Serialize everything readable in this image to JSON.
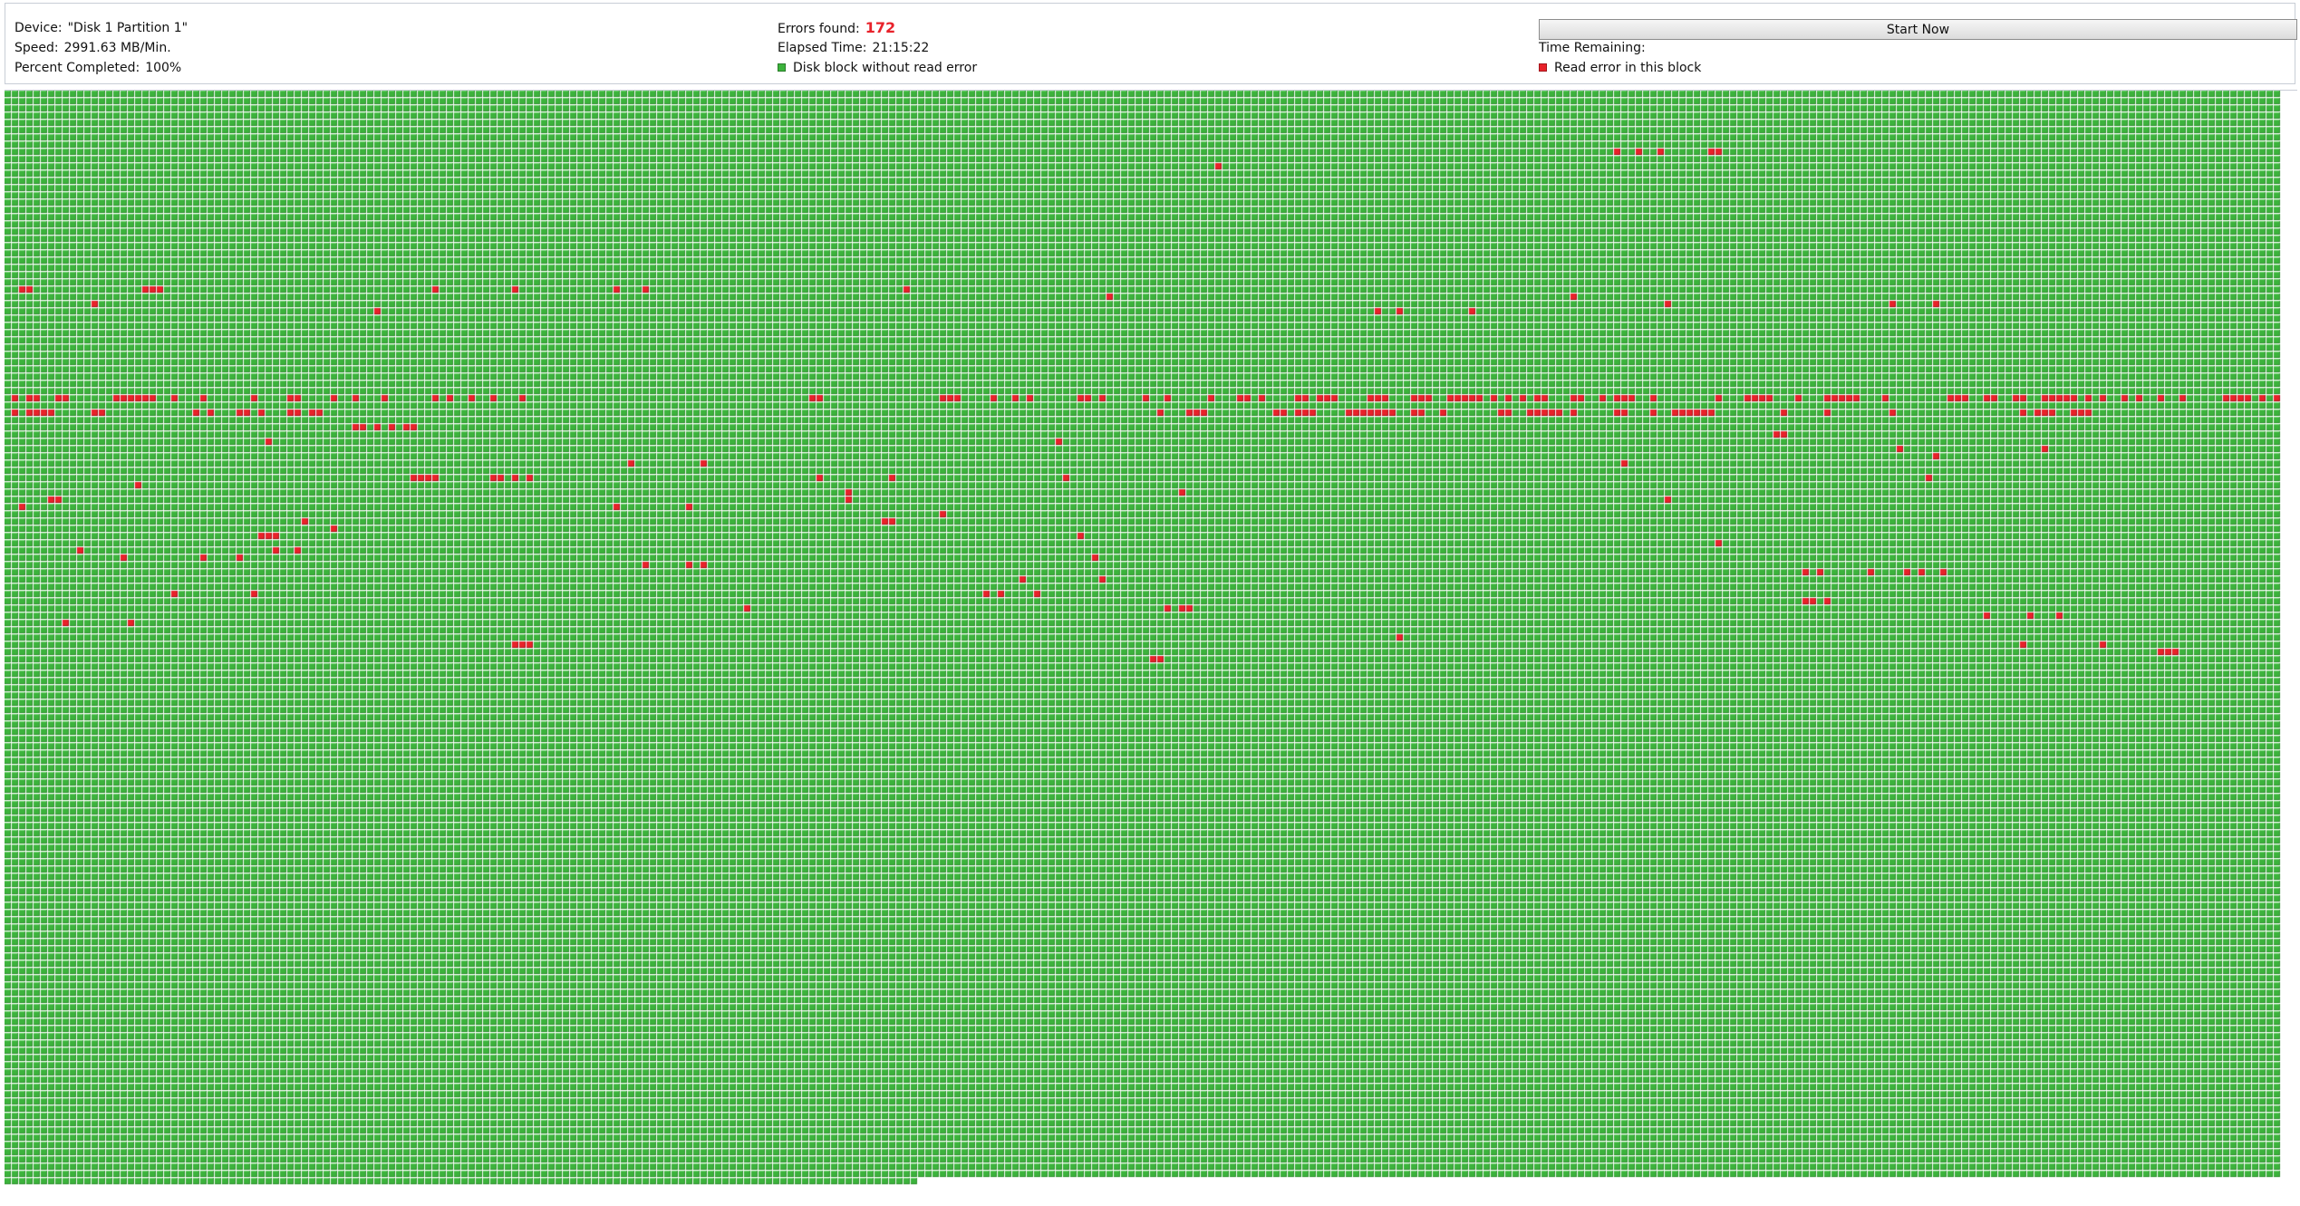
{
  "scan": {
    "device_label": "Device:",
    "device_value": "\"Disk 1 Partition 1\"",
    "speed_label": "Speed:",
    "speed_value": "2991.63 MB/Min.",
    "percent_label": "Percent Completed:",
    "percent_value": "100%",
    "percent_complete": 100,
    "errors_label": "Errors found:",
    "errors_value": "172",
    "elapsed_label": "Elapsed Time:",
    "elapsed_value": "21:15:22",
    "remaining_label": "Time Remaining:",
    "remaining_value": ""
  },
  "legend": {
    "ok_label": "Disk block without read error",
    "error_label": "Read error in this block"
  },
  "actions": {
    "start_label": "Start Now"
  },
  "colors": {
    "ok_block": "#3cb33c",
    "ok_block_highlight": "#6fd46f",
    "error_block": "#e8222a",
    "errors_text": "#e8222a"
  },
  "block_map": {
    "columns": 314,
    "rows": 151,
    "scanned_blocks": 47226,
    "error_blocks": [
      [
        8,
        222
      ],
      [
        8,
        225
      ],
      [
        8,
        228
      ],
      [
        8,
        235
      ],
      [
        8,
        236
      ],
      [
        10,
        167
      ],
      [
        27,
        2
      ],
      [
        27,
        3
      ],
      [
        27,
        19
      ],
      [
        27,
        20
      ],
      [
        27,
        21
      ],
      [
        27,
        59
      ],
      [
        27,
        70
      ],
      [
        27,
        84
      ],
      [
        27,
        88
      ],
      [
        27,
        124
      ],
      [
        28,
        152
      ],
      [
        28,
        216
      ],
      [
        29,
        12
      ],
      [
        29,
        229
      ],
      [
        29,
        260
      ],
      [
        29,
        266
      ],
      [
        30,
        51
      ],
      [
        30,
        189
      ],
      [
        30,
        192
      ],
      [
        30,
        202
      ],
      [
        42,
        1
      ],
      [
        42,
        3
      ],
      [
        42,
        4
      ],
      [
        42,
        7
      ],
      [
        42,
        8
      ],
      [
        42,
        15
      ],
      [
        42,
        16
      ],
      [
        42,
        17
      ],
      [
        42,
        18
      ],
      [
        42,
        19
      ],
      [
        42,
        20
      ],
      [
        42,
        23
      ],
      [
        42,
        27
      ],
      [
        42,
        34
      ],
      [
        42,
        39
      ],
      [
        42,
        40
      ],
      [
        42,
        45
      ],
      [
        42,
        48
      ],
      [
        42,
        52
      ],
      [
        42,
        59
      ],
      [
        42,
        61
      ],
      [
        42,
        64
      ],
      [
        42,
        67
      ],
      [
        42,
        71
      ],
      [
        42,
        111
      ],
      [
        42,
        112
      ],
      [
        42,
        129
      ],
      [
        42,
        130
      ],
      [
        42,
        131
      ],
      [
        42,
        136
      ],
      [
        42,
        139
      ],
      [
        42,
        141
      ],
      [
        42,
        148
      ],
      [
        42,
        149
      ],
      [
        42,
        151
      ],
      [
        42,
        157
      ],
      [
        42,
        160
      ],
      [
        42,
        166
      ],
      [
        42,
        170
      ],
      [
        42,
        171
      ],
      [
        42,
        173
      ],
      [
        42,
        178
      ],
      [
        42,
        179
      ],
      [
        42,
        181
      ],
      [
        42,
        182
      ],
      [
        42,
        183
      ],
      [
        42,
        188
      ],
      [
        42,
        189
      ],
      [
        42,
        190
      ],
      [
        42,
        194
      ],
      [
        42,
        195
      ],
      [
        42,
        196
      ],
      [
        42,
        199
      ],
      [
        42,
        200
      ],
      [
        42,
        201
      ],
      [
        42,
        202
      ],
      [
        42,
        203
      ],
      [
        42,
        205
      ],
      [
        42,
        207
      ],
      [
        42,
        209
      ],
      [
        42,
        211
      ],
      [
        42,
        212
      ],
      [
        42,
        216
      ],
      [
        42,
        217
      ],
      [
        42,
        220
      ],
      [
        42,
        222
      ],
      [
        42,
        223
      ],
      [
        42,
        224
      ],
      [
        42,
        227
      ],
      [
        42,
        236
      ],
      [
        42,
        240
      ],
      [
        42,
        241
      ],
      [
        42,
        242
      ],
      [
        42,
        243
      ],
      [
        42,
        247
      ],
      [
        42,
        251
      ],
      [
        42,
        252
      ],
      [
        42,
        253
      ],
      [
        42,
        254
      ],
      [
        42,
        255
      ],
      [
        42,
        259
      ],
      [
        42,
        268
      ],
      [
        42,
        269
      ],
      [
        42,
        270
      ],
      [
        42,
        273
      ],
      [
        42,
        274
      ],
      [
        42,
        277
      ],
      [
        42,
        278
      ],
      [
        42,
        281
      ],
      [
        42,
        282
      ],
      [
        42,
        283
      ],
      [
        42,
        284
      ],
      [
        42,
        285
      ],
      [
        42,
        287
      ],
      [
        42,
        289
      ],
      [
        42,
        292
      ],
      [
        42,
        294
      ],
      [
        42,
        297
      ],
      [
        42,
        300
      ],
      [
        42,
        306
      ],
      [
        42,
        307
      ],
      [
        42,
        308
      ],
      [
        42,
        309
      ],
      [
        42,
        311
      ],
      [
        42,
        313
      ],
      [
        44,
        1
      ],
      [
        44,
        3
      ],
      [
        44,
        4
      ],
      [
        44,
        5
      ],
      [
        44,
        6
      ],
      [
        44,
        12
      ],
      [
        44,
        13
      ],
      [
        44,
        26
      ],
      [
        44,
        28
      ],
      [
        44,
        32
      ],
      [
        44,
        33
      ],
      [
        44,
        35
      ],
      [
        44,
        39
      ],
      [
        44,
        40
      ],
      [
        44,
        42
      ],
      [
        44,
        43
      ],
      [
        44,
        159
      ],
      [
        44,
        163
      ],
      [
        44,
        164
      ],
      [
        44,
        165
      ],
      [
        44,
        175
      ],
      [
        44,
        176
      ],
      [
        44,
        178
      ],
      [
        44,
        179
      ],
      [
        44,
        180
      ],
      [
        44,
        185
      ],
      [
        44,
        186
      ],
      [
        44,
        187
      ],
      [
        44,
        188
      ],
      [
        44,
        189
      ],
      [
        44,
        190
      ],
      [
        44,
        191
      ],
      [
        44,
        194
      ],
      [
        44,
        195
      ],
      [
        44,
        198
      ],
      [
        44,
        206
      ],
      [
        44,
        207
      ],
      [
        44,
        210
      ],
      [
        44,
        211
      ],
      [
        44,
        212
      ],
      [
        44,
        213
      ],
      [
        44,
        214
      ],
      [
        44,
        216
      ],
      [
        44,
        222
      ],
      [
        44,
        223
      ],
      [
        44,
        227
      ],
      [
        44,
        230
      ],
      [
        44,
        231
      ],
      [
        44,
        232
      ],
      [
        44,
        233
      ],
      [
        44,
        234
      ],
      [
        44,
        235
      ],
      [
        44,
        245
      ],
      [
        44,
        251
      ],
      [
        44,
        260
      ],
      [
        44,
        278
      ],
      [
        44,
        280
      ],
      [
        44,
        281
      ],
      [
        44,
        282
      ],
      [
        44,
        285
      ],
      [
        44,
        286
      ],
      [
        44,
        287
      ],
      [
        46,
        48
      ],
      [
        46,
        49
      ],
      [
        46,
        51
      ],
      [
        46,
        53
      ],
      [
        46,
        55
      ],
      [
        46,
        56
      ],
      [
        47,
        244
      ],
      [
        47,
        245
      ],
      [
        48,
        36
      ],
      [
        48,
        145
      ],
      [
        49,
        261
      ],
      [
        49,
        281
      ],
      [
        50,
        266
      ],
      [
        51,
        86
      ],
      [
        51,
        96
      ],
      [
        51,
        223
      ],
      [
        53,
        56
      ],
      [
        53,
        57
      ],
      [
        53,
        58
      ],
      [
        53,
        59
      ],
      [
        53,
        67
      ],
      [
        53,
        68
      ],
      [
        53,
        70
      ],
      [
        53,
        72
      ],
      [
        53,
        112
      ],
      [
        53,
        122
      ],
      [
        53,
        146
      ],
      [
        53,
        265
      ],
      [
        54,
        18
      ],
      [
        55,
        116
      ],
      [
        55,
        162
      ],
      [
        56,
        6
      ],
      [
        56,
        7
      ],
      [
        56,
        116
      ],
      [
        56,
        229
      ],
      [
        57,
        2
      ],
      [
        57,
        84
      ],
      [
        57,
        94
      ],
      [
        58,
        129
      ],
      [
        59,
        41
      ],
      [
        59,
        121
      ],
      [
        59,
        122
      ],
      [
        60,
        45
      ],
      [
        61,
        35
      ],
      [
        61,
        36
      ],
      [
        61,
        37
      ],
      [
        61,
        148
      ],
      [
        62,
        236
      ],
      [
        63,
        10
      ],
      [
        63,
        37
      ],
      [
        63,
        40
      ],
      [
        64,
        16
      ],
      [
        64,
        27
      ],
      [
        64,
        32
      ],
      [
        64,
        150
      ],
      [
        65,
        88
      ],
      [
        65,
        94
      ],
      [
        65,
        96
      ],
      [
        66,
        248
      ],
      [
        66,
        250
      ],
      [
        66,
        257
      ],
      [
        66,
        262
      ],
      [
        66,
        264
      ],
      [
        66,
        267
      ],
      [
        67,
        140
      ],
      [
        67,
        151
      ],
      [
        69,
        23
      ],
      [
        69,
        34
      ],
      [
        69,
        135
      ],
      [
        69,
        137
      ],
      [
        69,
        142
      ],
      [
        70,
        248
      ],
      [
        70,
        249
      ],
      [
        70,
        251
      ],
      [
        71,
        102
      ],
      [
        71,
        160
      ],
      [
        71,
        162
      ],
      [
        71,
        163
      ],
      [
        72,
        273
      ],
      [
        72,
        279
      ],
      [
        72,
        283
      ],
      [
        73,
        8
      ],
      [
        73,
        17
      ],
      [
        75,
        192
      ],
      [
        76,
        70
      ],
      [
        76,
        71
      ],
      [
        76,
        72
      ],
      [
        76,
        278
      ],
      [
        76,
        289
      ],
      [
        77,
        297
      ],
      [
        77,
        298
      ],
      [
        77,
        299
      ],
      [
        78,
        158
      ],
      [
        78,
        159
      ]
    ]
  }
}
